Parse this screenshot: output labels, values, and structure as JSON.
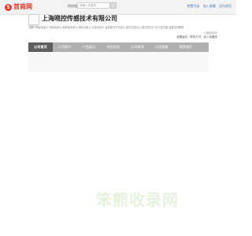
{
  "topbar": {
    "logo_mark": "S",
    "logo_text": "首商网",
    "search_label": "供应搜索",
    "search_placeholder": "请输入关键词",
    "links": [
      "免费开店",
      "加入收藏",
      "设为首页"
    ]
  },
  "company": {
    "logo_placeholder": "首商网",
    "name": "上海晓控传感技术有限公司",
    "description": "主营：电磁流量计,涡街流量计,超声波流量计,涡轮流量计,孔板流量计,金属管浮子流量计,差压式液位计,雷达物位计,压力变送器,温度变送器等",
    "url": "(当前访问)",
    "header_links": [
      "我要留言",
      "联系方式",
      "加入收藏夹"
    ]
  },
  "nav": {
    "items": [
      {
        "label": "公司首页",
        "active": true
      },
      {
        "label": "公司简介",
        "active": false
      },
      {
        "label": "产品展示",
        "active": false
      },
      {
        "label": "供应信息",
        "active": false
      },
      {
        "label": "公司新闻",
        "active": false
      },
      {
        "label": "公司相册",
        "active": false
      },
      {
        "label": "联系我们",
        "active": false
      }
    ]
  },
  "watermark": {
    "text": "笨熊收录网"
  }
}
